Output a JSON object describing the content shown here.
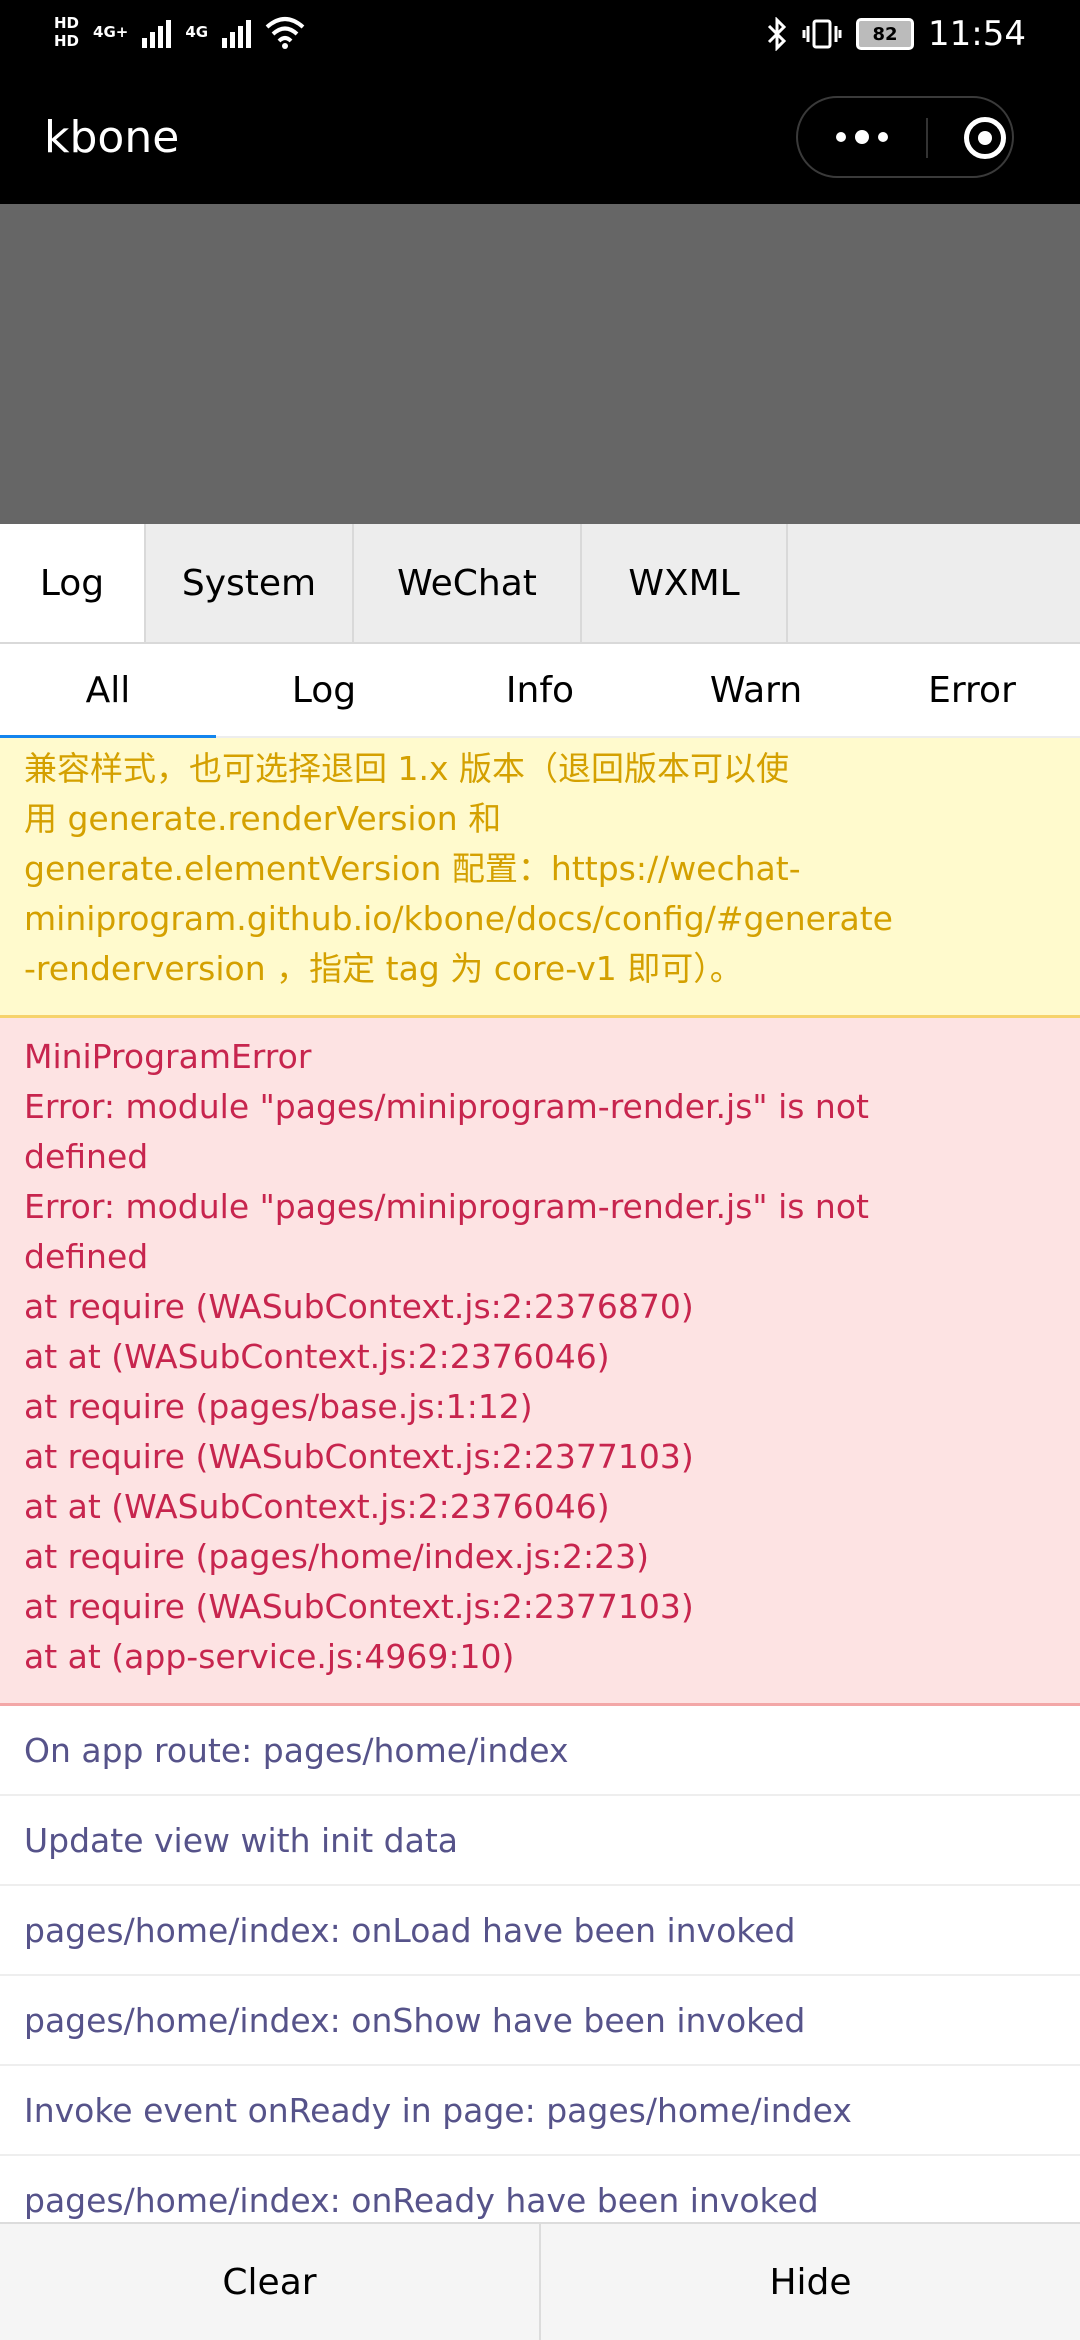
{
  "status_bar": {
    "hd1": "HD",
    "hd2": "HD",
    "net1": "4G+",
    "net2": "4G",
    "battery": "82",
    "time": "11:54"
  },
  "nav": {
    "title": "kbone"
  },
  "tabs": [
    {
      "label": "Log"
    },
    {
      "label": "System"
    },
    {
      "label": "WeChat"
    },
    {
      "label": "WXML"
    }
  ],
  "subtabs": [
    {
      "label": "All"
    },
    {
      "label": "Log"
    },
    {
      "label": "Info"
    },
    {
      "label": "Warn"
    },
    {
      "label": "Error"
    }
  ],
  "warn_log": {
    "text": "兼容样式，也可选择退回 1.x 版本（退回版本可以使\n用 generate.renderVersion 和\ngenerate.elementVersion 配置：https://wechat-\nminiprogram.github.io/kbone/docs/config/#generate\n-renderversion ，指定 tag 为 core-v1 即可）。"
  },
  "error_log": {
    "lines": [
      "MiniProgramError",
      "Error: module \"pages/miniprogram-render.js\" is not",
      "defined",
      "Error: module \"pages/miniprogram-render.js\" is not",
      "defined",
      "at require (WASubContext.js:2:2376870)",
      "at at (WASubContext.js:2:2376046)",
      "at require (pages/base.js:1:12)",
      "at require (WASubContext.js:2:2377103)",
      "at at (WASubContext.js:2:2376046)",
      "at require (pages/home/index.js:2:23)",
      "at require (WASubContext.js:2:2377103)",
      "at at (app-service.js:4969:10)"
    ]
  },
  "logs": [
    "On app route: pages/home/index",
    "Update view with init data",
    "pages/home/index: onLoad have been invoked",
    "pages/home/index: onShow have been invoked",
    "Invoke event onReady in page: pages/home/index",
    "pages/home/index: onReady have been invoked"
  ],
  "toolbar": {
    "clear": "Clear",
    "hide": "Hide"
  }
}
